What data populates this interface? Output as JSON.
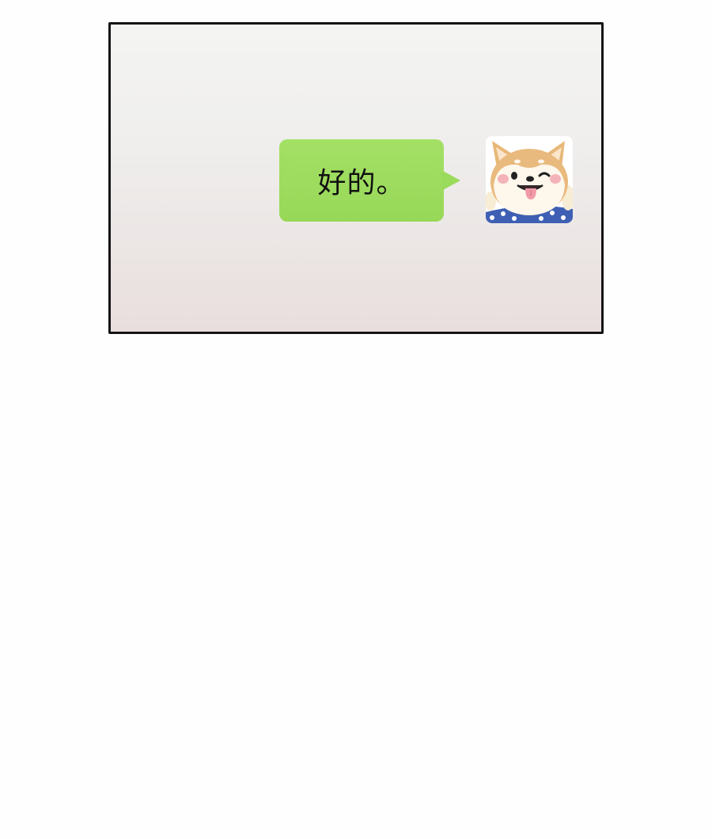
{
  "chat": {
    "messages": [
      {
        "text": "好的。",
        "sender": "self",
        "avatar_icon": "shiba-dog-avatar-icon"
      }
    ]
  },
  "colors": {
    "bubble": "#9bdb5c",
    "panel_border": "#141414",
    "page_background": "#fefefe"
  }
}
